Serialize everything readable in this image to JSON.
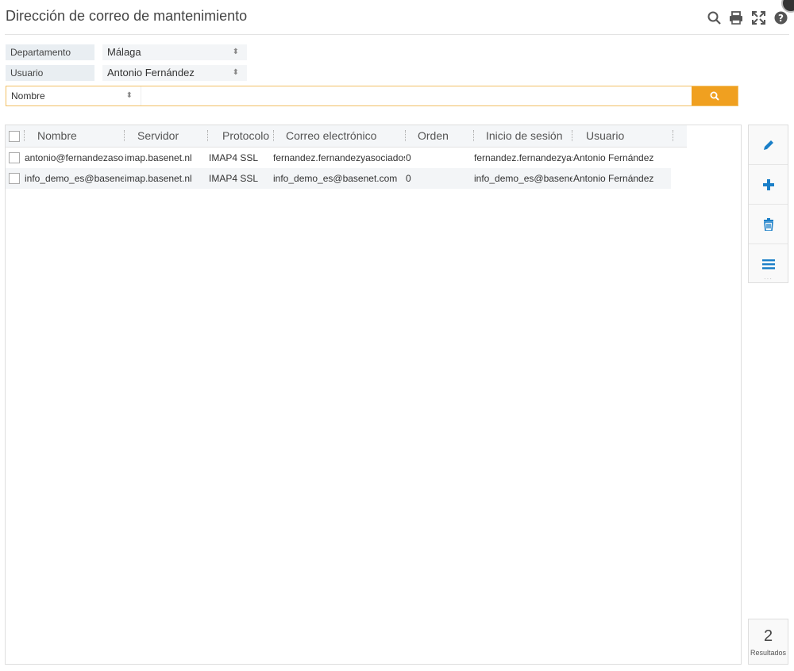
{
  "page": {
    "title": "Dirección de correo de mantenimiento"
  },
  "toolbar": {
    "icons": [
      "search-icon",
      "print-icon",
      "expand-icon",
      "help-icon"
    ]
  },
  "filters": {
    "department": {
      "label": "Departamento",
      "value": "Málaga"
    },
    "user": {
      "label": "Usuario",
      "value": "Antonio Fernández"
    }
  },
  "search": {
    "field": "Nombre",
    "value": ""
  },
  "table": {
    "headers": [
      "Nombre",
      "Servidor",
      "Protocolo",
      "Correo electrónico",
      "Orden",
      "Inicio de sesión",
      "Usuario"
    ],
    "rows": [
      [
        "antonio@fernandezasoc",
        "imap.basenet.nl",
        "IMAP4 SSL",
        "fernandez.fernandezyasociados",
        "0",
        "fernandez.fernandezyas",
        "Antonio Fernández"
      ],
      [
        "info_demo_es@basene",
        "imap.basenet.nl",
        "IMAP4 SSL",
        "info_demo_es@basenet.com",
        "0",
        "info_demo_es@basene",
        "Antonio Fernández"
      ]
    ]
  },
  "sidebar": {
    "actions": [
      "edit-icon",
      "add-icon",
      "delete-icon",
      "menu-icon"
    ]
  },
  "results": {
    "count": "2",
    "label": "Resultados"
  },
  "colors": {
    "accent": "#f0a020",
    "action_blue": "#1a7fc8",
    "header_bg": "#f4f6f8"
  }
}
